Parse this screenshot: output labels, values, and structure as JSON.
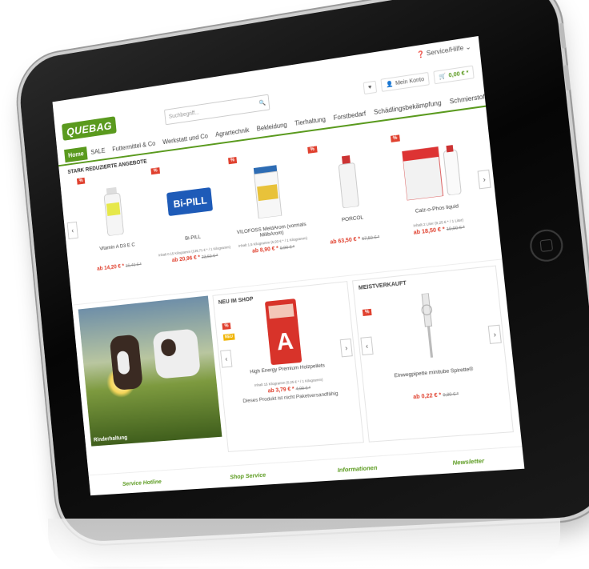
{
  "topbar": {
    "service_label": "Service/Hilfe"
  },
  "header": {
    "logo": "QUEBAG",
    "search_placeholder": "Suchbegriff...",
    "account_label": "Mein Konto",
    "cart_total": "0,00 € *"
  },
  "nav": {
    "items": [
      "Home",
      "SALE",
      "Futtermittel & Co",
      "Werkstatt und Co",
      "Agrartechnik",
      "Bekleidung",
      "Tierhaltung",
      "Forstbedarf",
      "Schädlingsbekämpfung",
      "Schmierstoffe"
    ]
  },
  "deals": {
    "title": "STARK REDUZIERTE ANGEBOTE",
    "badge": "%",
    "products": [
      {
        "name": "Vitamin A D3 E C",
        "meta": "",
        "price": "ab 14,20 € *",
        "old": "16,40 € *"
      },
      {
        "name": "Bi-PILL",
        "meta": "Inhalt 0.15 Kilogramm (139,71 € * / 1 Kilogramm)",
        "price": "ab 20,96 € *",
        "old": "23,60 € *"
      },
      {
        "name": "VILOFOSS MeldArom (vormals MilibArom)",
        "meta": "Inhalt 1,5 Kilogramm (6,93 € * / 1 Kilogramm)",
        "price": "ab 8,90 € *",
        "old": "9,90 € *"
      },
      {
        "name": "PORCOL",
        "meta": "",
        "price": "ab 63,50 € *",
        "old": "67,50 € *"
      },
      {
        "name": "Calz-o-Phos liquid",
        "meta": "Inhalt 2 Liter (9,25 € * / 1 Liter)",
        "price": "ab 18,50 € *",
        "old": "19,90 € *"
      }
    ]
  },
  "cows_label": "Rinderhaltung",
  "new_in_shop": {
    "title": "NEU IM SHOP",
    "badge": "%",
    "neu_badge": "NEU",
    "product_name": "High Energy Premium Holzpellets",
    "meta": "Inhalt 15 Kilogramm (0,25 € * / 1 Kilogramm)",
    "price": "ab 3,79 € *",
    "old": "4,09 € *",
    "note": "Dieses Produkt ist nicht Paketversandfähig"
  },
  "bestseller": {
    "title": "MEISTVERKAUFT",
    "badge": "%",
    "product_name": "Einwegpipette minitube Spirette®",
    "price": "ab 0,22 € *",
    "old": "0,30 € *"
  },
  "footer": [
    "Service Hotline",
    "Shop Service",
    "Informationen",
    "Newsletter"
  ]
}
